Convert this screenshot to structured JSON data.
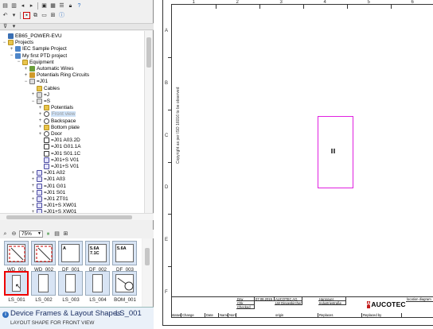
{
  "toolbar_top": {
    "icons": [
      "new-icon",
      "open-icon",
      "back-icon",
      "forward-icon",
      "window-icon",
      "grid-icon",
      "properties-icon",
      "lock-icon",
      "help-icon",
      "undo-icon",
      "redo-icon",
      "cut-icon",
      "copy-icon",
      "paste-icon",
      "info-icon"
    ]
  },
  "filter_bar": {
    "icons": [
      "filter-icon",
      "filter-dropdown-icon"
    ]
  },
  "tree": {
    "items": [
      {
        "label": "EB65_POWER-EVU",
        "level": 0,
        "icon": "database-icon",
        "expanded": "none"
      },
      {
        "label": "Projects",
        "level": 0,
        "icon": "folder-icon",
        "expanded": "minus"
      },
      {
        "label": "IEC Sample Project",
        "level": 1,
        "icon": "project-icon",
        "expanded": "plus"
      },
      {
        "label": "My first PTD project",
        "level": 1,
        "icon": "project-icon",
        "expanded": "minus"
      },
      {
        "label": "Equipment",
        "level": 2,
        "icon": "folder-icon",
        "expanded": "minus"
      },
      {
        "label": "Automatic Wires",
        "level": 3,
        "icon": "wire-icon",
        "expanded": "plus"
      },
      {
        "label": "Potentials Ring Circuits",
        "level": 3,
        "icon": "potential-icon",
        "expanded": "plus"
      },
      {
        "label": "=J01",
        "level": 3,
        "icon": "device-icon",
        "expanded": "minus"
      },
      {
        "label": "Cables",
        "level": 4,
        "icon": "folder-icon",
        "expanded": "none"
      },
      {
        "label": "=J",
        "level": 4,
        "icon": "device-icon",
        "expanded": "plus"
      },
      {
        "label": "=S",
        "level": 4,
        "icon": "device-icon",
        "expanded": "minus"
      },
      {
        "label": "Potentials",
        "level": 5,
        "icon": "folder-icon",
        "expanded": "plus"
      },
      {
        "label": "Front view",
        "level": 5,
        "icon": "door-icon",
        "expanded": "plus",
        "selected": true
      },
      {
        "label": "Backspace",
        "level": 5,
        "icon": "door-icon",
        "expanded": "plus"
      },
      {
        "label": "Bottom plate",
        "level": 5,
        "icon": "folder-icon",
        "expanded": "plus"
      },
      {
        "label": "Door",
        "level": 5,
        "icon": "door-icon",
        "expanded": "plus"
      },
      {
        "label": "=J01 A03.2D",
        "level": 5,
        "icon": "terminal-icon",
        "expanded": "none"
      },
      {
        "label": "=J01 G01.1A",
        "level": 5,
        "icon": "terminal-icon",
        "expanded": "none"
      },
      {
        "label": "=J01 S01.1C",
        "level": 5,
        "icon": "terminal-icon",
        "expanded": "none"
      },
      {
        "label": "=J01+S V01",
        "level": 5,
        "icon": "component-icon",
        "expanded": "none"
      },
      {
        "label": "=J01+S V01",
        "level": 5,
        "icon": "component-icon",
        "expanded": "none"
      },
      {
        "label": "=J01 A02",
        "level": 4,
        "icon": "component-icon",
        "expanded": "plus"
      },
      {
        "label": "=J01 A03",
        "level": 4,
        "icon": "component-icon",
        "expanded": "plus"
      },
      {
        "label": "=J01 G01",
        "level": 4,
        "icon": "component-icon",
        "expanded": "plus"
      },
      {
        "label": "=J01 S01",
        "level": 4,
        "icon": "component-icon",
        "expanded": "plus"
      },
      {
        "label": "=J01 ZT01",
        "level": 4,
        "icon": "component-icon",
        "expanded": "plus"
      },
      {
        "label": "=J01+S XW01",
        "level": 4,
        "icon": "component-icon",
        "expanded": "plus"
      },
      {
        "label": "=J01+S XW01",
        "level": 4,
        "icon": "component-icon",
        "expanded": "plus"
      }
    ]
  },
  "shapes_toolbar": {
    "zoom": "75%"
  },
  "shapes": {
    "row1": [
      {
        "label": "WD_001",
        "glyph": "",
        "active": false
      },
      {
        "label": "WD_002",
        "glyph": "",
        "active": false
      },
      {
        "label": "DF_001",
        "glyph": "A",
        "active": false
      },
      {
        "label": "DF_002",
        "glyph": "5.6A 7.1C",
        "active": false
      },
      {
        "label": "DF_003",
        "glyph": "5.6A",
        "active": false
      }
    ],
    "row2": [
      {
        "label": "LS_001",
        "active": true
      },
      {
        "label": "LS_002",
        "active": false
      },
      {
        "label": "LS_003",
        "active": false
      },
      {
        "label": "LS_004",
        "active": false
      },
      {
        "label": "BOM_001",
        "active": false
      }
    ]
  },
  "tooltip": {
    "title": "Device Frames & Layout Shapes",
    "code": "LS_001",
    "description": "LAYOUT SHAPE FOR FRONT VIEW"
  },
  "sheet": {
    "columns": [
      "1",
      "2",
      "3",
      "4",
      "5",
      "6"
    ],
    "rows": [
      "A",
      "B",
      "C",
      "D",
      "E",
      "F"
    ],
    "copyright": "Copyright as per ISO 16016 to be observed",
    "title_block": {
      "date": "07.08.2015",
      "company": "AUCOTEC AG",
      "company_addr": "LW Dingeskirchen",
      "city": "Hannover",
      "industry": "Industriestraße",
      "origin": "origin",
      "replace": "Replaces",
      "replaced_by": "Replaced by",
      "location": "location diagram",
      "status": "status",
      "change": "Change",
      "date_label": "Date",
      "name": "Name",
      "norm": "Norm",
      "row_labels": [
        "Drw",
        "Chk",
        "Checked"
      ],
      "logo": "AUCOTEC"
    }
  }
}
